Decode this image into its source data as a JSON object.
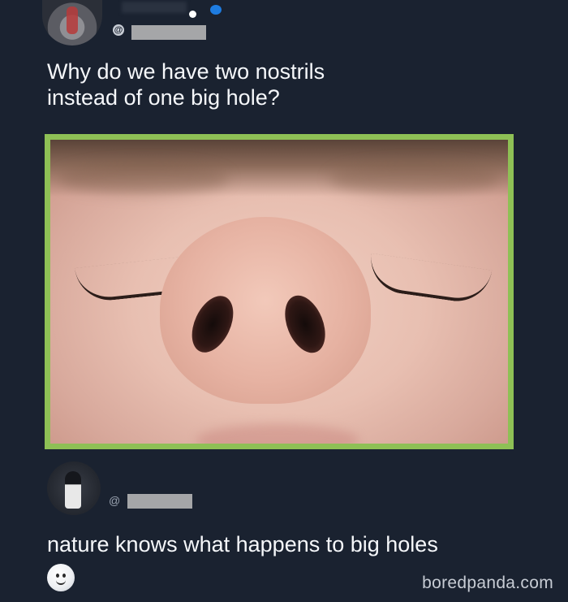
{
  "post": {
    "question": "Why do we have two nostrils\ninstead of one big hole?"
  },
  "reply": {
    "at_sign": "@",
    "text": "nature knows what happens to big holes",
    "emoji_icon": "slightly-smiling-face-icon"
  },
  "watermark": "boredpanda.com",
  "colors": {
    "background": "#1a2230",
    "image_border": "#8ec055",
    "redaction": "#a5a6a8"
  }
}
